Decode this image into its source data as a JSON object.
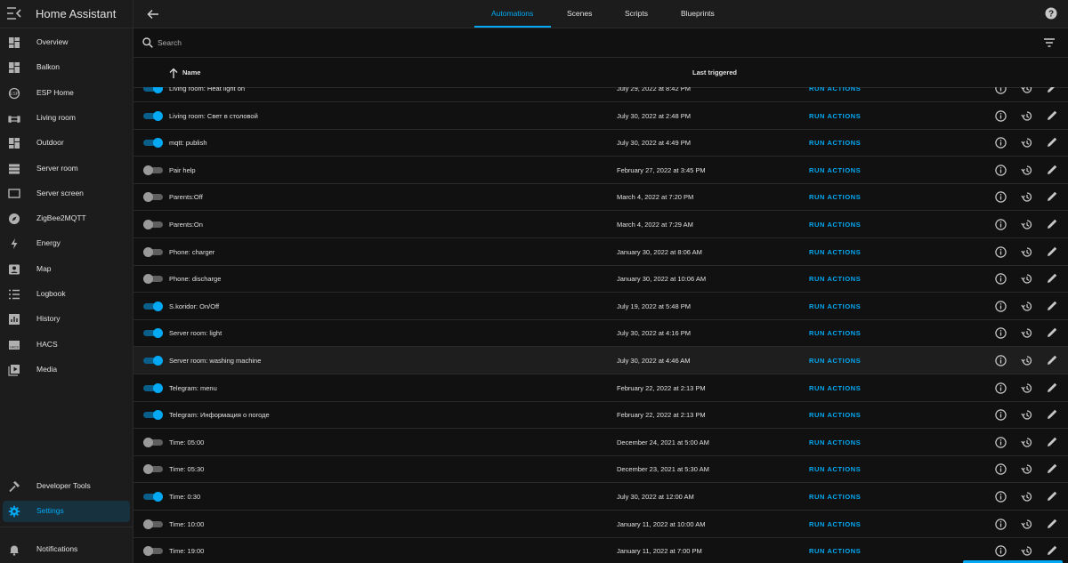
{
  "app": {
    "title": "Home Assistant"
  },
  "sidebar": {
    "items": [
      {
        "label": "Overview",
        "icon": "dashboard-icon"
      },
      {
        "label": "Balkon",
        "icon": "dashboard-icon"
      },
      {
        "label": "ESP Home",
        "icon": "esphome-icon"
      },
      {
        "label": "Living room",
        "icon": "sofa-icon"
      },
      {
        "label": "Outdoor",
        "icon": "dashboard-icon"
      },
      {
        "label": "Server room",
        "icon": "server-icon"
      },
      {
        "label": "Server screen",
        "icon": "monitor-icon"
      },
      {
        "label": "ZigBee2MQTT",
        "icon": "compass-icon"
      },
      {
        "label": "Energy",
        "icon": "lightning-bolt-icon"
      },
      {
        "label": "Map",
        "icon": "map-account-icon"
      },
      {
        "label": "Logbook",
        "icon": "list-icon"
      },
      {
        "label": "History",
        "icon": "chart-box-icon"
      },
      {
        "label": "HACS",
        "icon": "hacs-icon"
      },
      {
        "label": "Media",
        "icon": "play-box-multiple-icon"
      }
    ],
    "bottom": [
      {
        "label": "Developer Tools",
        "icon": "hammer-icon"
      },
      {
        "label": "Settings",
        "icon": "cog-icon",
        "active": true
      }
    ],
    "notifications": {
      "label": "Notifications",
      "icon": "bell-icon"
    }
  },
  "topbar": {
    "tabs": [
      {
        "label": "Automations",
        "active": true
      },
      {
        "label": "Scenes",
        "active": false
      },
      {
        "label": "Scripts",
        "active": false
      },
      {
        "label": "Blueprints",
        "active": false
      }
    ]
  },
  "search": {
    "placeholder": "Search"
  },
  "table": {
    "columns": {
      "name": "Name",
      "last_triggered": "Last triggered"
    },
    "sort": {
      "column": "Name",
      "direction": "ascending"
    },
    "action_label": "RUN ACTIONS",
    "rows": [
      {
        "name": "Living room: Heat light on",
        "last_triggered": "July 29, 2022 at 8:42 PM",
        "enabled": true
      },
      {
        "name": "Living room: Свет в столовой",
        "last_triggered": "July 30, 2022 at 2:48 PM",
        "enabled": true
      },
      {
        "name": "mqtt: publish",
        "last_triggered": "July 30, 2022 at 4:49 PM",
        "enabled": true
      },
      {
        "name": "Pair help",
        "last_triggered": "February 27, 2022 at 3:45 PM",
        "enabled": false
      },
      {
        "name": "Parents:Off",
        "last_triggered": "March 4, 2022 at 7:20 PM",
        "enabled": false
      },
      {
        "name": "Parents:On",
        "last_triggered": "March 4, 2022 at 7:29 AM",
        "enabled": false
      },
      {
        "name": "Phone: charger",
        "last_triggered": "January 30, 2022 at 8:06 AM",
        "enabled": false
      },
      {
        "name": "Phone: discharge",
        "last_triggered": "January 30, 2022 at 10:06 AM",
        "enabled": false
      },
      {
        "name": "S.koridor: On/Off",
        "last_triggered": "July 19, 2022 at 5:48 PM",
        "enabled": true
      },
      {
        "name": "Server room: light",
        "last_triggered": "July 30, 2022 at 4:16 PM",
        "enabled": true
      },
      {
        "name": "Server room: washing machine",
        "last_triggered": "July 30, 2022 at 4:46 AM",
        "enabled": true,
        "highlighted": true
      },
      {
        "name": "Telegram: menu",
        "last_triggered": "February 22, 2022 at 2:13 PM",
        "enabled": true
      },
      {
        "name": "Telegram: Информация о погоде",
        "last_triggered": "February 22, 2022 at 2:13 PM",
        "enabled": true
      },
      {
        "name": "Time: 05:00",
        "last_triggered": "December 24, 2021 at 5:00 AM",
        "enabled": false
      },
      {
        "name": "Time: 05:30",
        "last_triggered": "December 23, 2021 at 5:30 AM",
        "enabled": false
      },
      {
        "name": "Time: 0:30",
        "last_triggered": "July 30, 2022 at 12:00 AM",
        "enabled": true
      },
      {
        "name": "Time: 10:00",
        "last_triggered": "January 11, 2022 at 10:00 AM",
        "enabled": false
      },
      {
        "name": "Time: 19:00",
        "last_triggered": "January 11, 2022 at 7:00 PM",
        "enabled": false
      }
    ]
  },
  "colors": {
    "accent": "#03a9f4",
    "background": "#111111",
    "sidebar": "#1c1c1c"
  }
}
